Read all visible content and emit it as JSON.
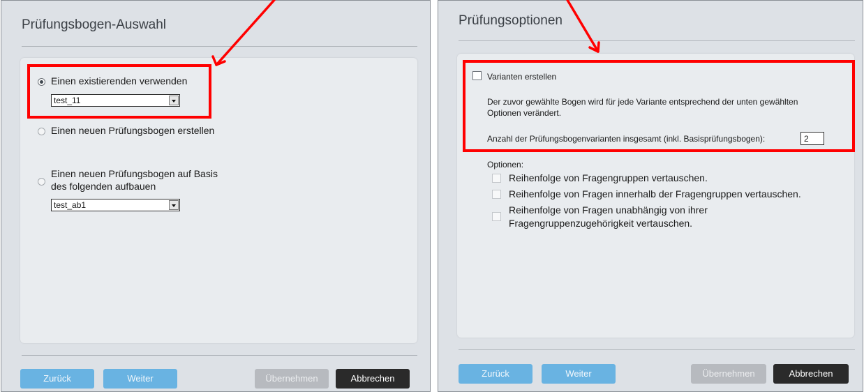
{
  "left": {
    "title": "Prüfungsbogen-Auswahl",
    "option_existing": "Einen existierenden verwenden",
    "existing_select_value": "test_11",
    "option_new": "Einen neuen Prüfungsbogen erstellen",
    "option_base_line1": "Einen neuen Prüfungsbogen auf Basis",
    "option_base_line2": "des folgenden aufbauen",
    "base_select_value": "test_ab1",
    "buttons": {
      "back": "Zurück",
      "next": "Weiter",
      "apply": "Übernehmen",
      "cancel": "Abbrechen"
    }
  },
  "right": {
    "title": "Prüfungsoptionen",
    "variants_label": "Varianten erstellen",
    "description_line1": "Der zuvor gewählte Bogen wird für jede Variante entsprechend der unten gewählten",
    "description_line2": "Optionen verändert.",
    "count_label": "Anzahl der Prüfungsbogenvarianten insgesamt (inkl. Basisprüfungsbogen):",
    "count_value": "2",
    "options_heading": "Optionen:",
    "option1": "Reihenfolge von Fragengruppen vertauschen.",
    "option2": "Reihenfolge von Fragen innerhalb der Fragengruppen vertauschen.",
    "option3_line1": "Reihenfolge von Fragen unabhängig von ihrer",
    "option3_line2": "Fragengruppenzugehörigkeit vertauschen.",
    "buttons": {
      "back": "Zurück",
      "next": "Weiter",
      "apply": "Übernehmen",
      "cancel": "Abbrechen"
    }
  },
  "colors": {
    "annotation": "#ff0000",
    "button_blue": "#69b3e2",
    "button_disabled": "#b7babf",
    "button_dark": "#2a2a2a"
  }
}
